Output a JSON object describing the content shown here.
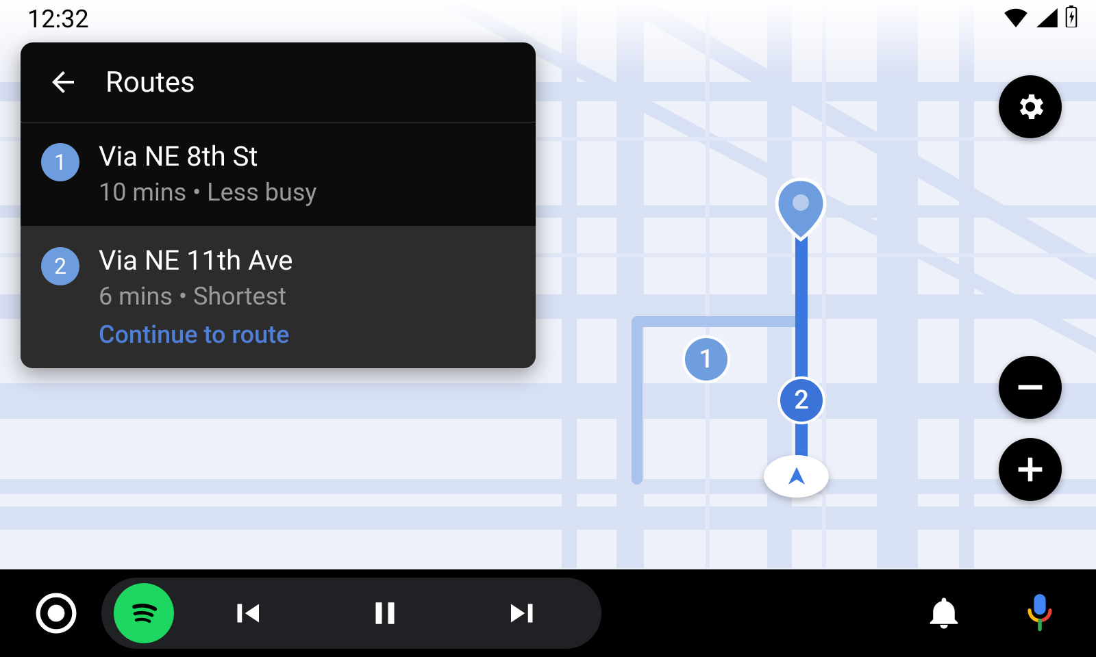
{
  "status_bar": {
    "time": "12:32",
    "icons": [
      "wifi-icon",
      "cell-signal-icon",
      "battery-charging-icon"
    ]
  },
  "routes_panel": {
    "title": "Routes",
    "items": [
      {
        "badge": "1",
        "title": "Via NE 8th St",
        "subtitle": "10 mins • Less busy",
        "selected": false,
        "cta": null
      },
      {
        "badge": "2",
        "title": "Via NE 11th Ave",
        "subtitle": "6 mins • Shortest",
        "selected": true,
        "cta": "Continue to route"
      }
    ]
  },
  "map": {
    "markers": [
      {
        "label": "1",
        "variant": "alt"
      },
      {
        "label": "2",
        "variant": "primary"
      }
    ],
    "route_colors": {
      "primary": "#3a78df",
      "alt": "#a9c3ec"
    }
  },
  "controls": {
    "settings": "settings",
    "zoom_out": "zoom-out",
    "zoom_in": "zoom-in"
  },
  "bottom_bar": {
    "launcher": "launcher",
    "music_app": "spotify",
    "media": [
      "previous",
      "pause",
      "next"
    ],
    "right": [
      "notifications",
      "voice-assistant"
    ]
  }
}
